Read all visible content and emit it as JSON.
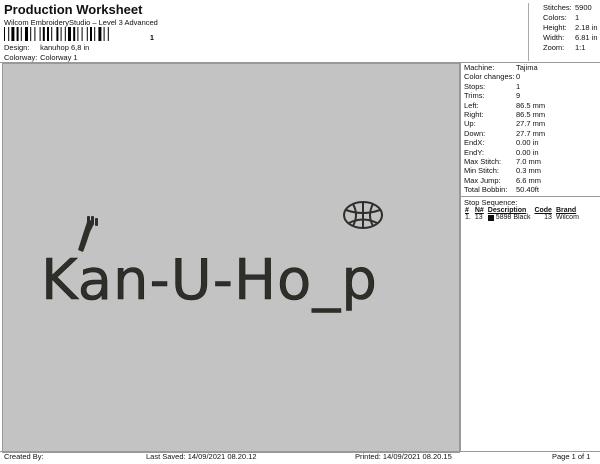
{
  "header": {
    "title": "Production Worksheet",
    "software": "Wilcom EmbroideryStudio – Level 3 Advanced",
    "barcode_mark": "1",
    "design_label": "Design:",
    "design_value": "kanuhop 6,8 in",
    "colorway_label": "Colorway:",
    "colorway_value": "Colorway 1"
  },
  "stats": [
    {
      "label": "Stitches:",
      "value": "5900"
    },
    {
      "label": "Colors:",
      "value": "1"
    },
    {
      "label": "Height:",
      "value": "2.18 in"
    },
    {
      "label": "Width:",
      "value": "6.81 in"
    },
    {
      "label": "Zoom:",
      "value": "1:1"
    }
  ],
  "machine": [
    {
      "label": "Machine:",
      "value": "Tajima"
    },
    {
      "label": "Color changes:",
      "value": "0"
    },
    {
      "label": "Stops:",
      "value": "1"
    },
    {
      "label": "Trims:",
      "value": "9"
    },
    {
      "label": "Left:",
      "value": "86.5 mm"
    },
    {
      "label": "Right:",
      "value": "86.5 mm"
    },
    {
      "label": "Up:",
      "value": "27.7 mm"
    },
    {
      "label": "Down:",
      "value": "27.7 mm"
    },
    {
      "label": "EndX:",
      "value": "0.00 in"
    },
    {
      "label": "EndY:",
      "value": "0.00 in"
    },
    {
      "label": "Max Stitch:",
      "value": "7.0 mm"
    },
    {
      "label": "Min Stitch:",
      "value": "0.3 mm"
    },
    {
      "label": "Max Jump:",
      "value": "6.6 mm"
    },
    {
      "label": "Total Bobbin:",
      "value": "50.40ft"
    }
  ],
  "stop_sequence": {
    "title": "Stop Sequence:",
    "columns": [
      "#",
      "N#",
      "Description",
      "Code",
      "Brand"
    ],
    "rows": [
      {
        "num": "1.",
        "n": "13",
        "thread": "5898",
        "description": "Black",
        "code": "13",
        "brand": "Wilcom"
      }
    ]
  },
  "design_text": "Kan-U-Ho_p",
  "colors": {
    "thread": "#2f2f2a",
    "background": "#c3c3c3"
  },
  "footer": {
    "created_by": "Created By:",
    "last_saved": "Last Saved: 14/09/2021 08.20.12",
    "printed": "Printed: 14/09/2021 08.20.15",
    "page": "Page 1 of 1"
  }
}
